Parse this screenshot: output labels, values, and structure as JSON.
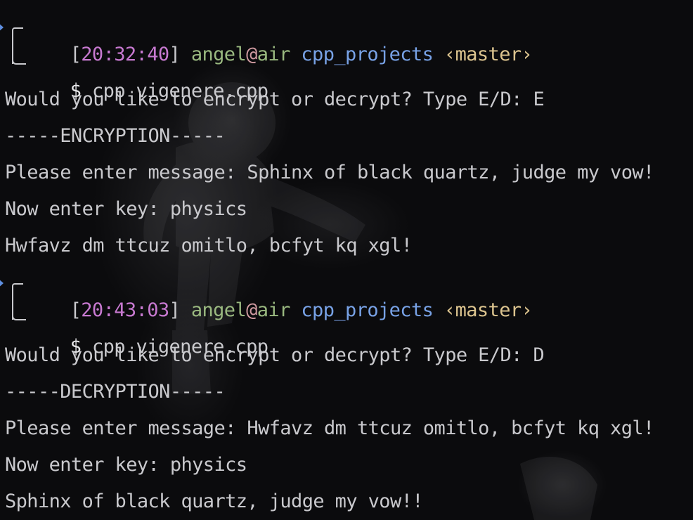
{
  "sessions": [
    {
      "prompt": {
        "time": "20:32:40",
        "user": "angel",
        "at": "@",
        "host": "air",
        "directory": "cpp_projects",
        "branch": "‹master›",
        "dollar": "$",
        "command": "cpp vigenere.cpp"
      },
      "output": [
        "Would you like to encrypt or decrypt? Type E/D: E",
        "-----ENCRYPTION-----",
        "Please enter message: Sphinx of black quartz, judge my vow!",
        "Now enter key: physics",
        "Hwfavz dm ttcuz omitlo, bcfyt kq xgl!"
      ]
    },
    {
      "prompt": {
        "time": "20:43:03",
        "user": "angel",
        "at": "@",
        "host": "air",
        "directory": "cpp_projects",
        "branch": "‹master›",
        "dollar": "$",
        "command": "cpp vigenere.cpp"
      },
      "output": [
        "Would you like to encrypt or decrypt? Type E/D: D",
        "-----DECRYPTION-----",
        "Please enter message: Hwfavz dm ttcuz omitlo, bcfyt kq xgl!",
        "Now enter key: physics",
        "Sphinx of black quartz, judge my vow!!"
      ]
    }
  ],
  "colors": {
    "text": "#c9c9cd",
    "time": "#c779d0",
    "user": "#9ab980",
    "at": "#cf9aa0",
    "directory": "#78a2e6",
    "branch": "#dcc48f",
    "prompt_marker": "#5f8fe0",
    "background": "#0b0b0d"
  },
  "icons": {
    "prompt_marker": "triangle-right-icon"
  }
}
